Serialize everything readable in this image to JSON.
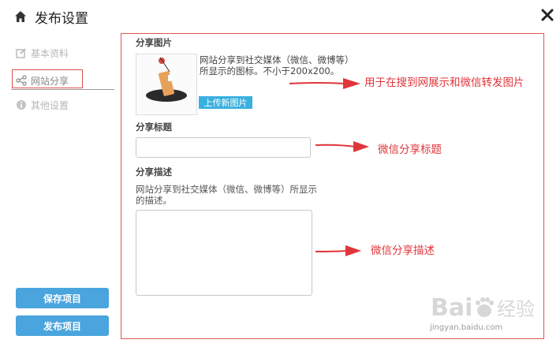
{
  "header": {
    "title": "发布设置"
  },
  "sidebar": {
    "items": [
      {
        "label": "基本资料",
        "icon": "edit-icon"
      },
      {
        "label": "网站分享",
        "icon": "share-icon"
      },
      {
        "label": "其他设置",
        "icon": "info-icon"
      }
    ],
    "save_label": "保存项目",
    "publish_label": "发布项目"
  },
  "main": {
    "share_image_label": "分享图片",
    "share_image_hint": "网站分享到社交媒体（微信、微博等）所显示的图标。不小于200x200。",
    "upload_label": "上传新图片",
    "share_title_label": "分享标题",
    "share_title_value": "",
    "share_desc_label": "分享描述",
    "share_desc_hint": "网站分享到社交媒体（微信、微博等）所显示的描述。",
    "share_desc_value": ""
  },
  "annotations": {
    "image_note": "用于在搜到网展示和微信转发图片",
    "title_note": "微信分享标题",
    "desc_note": "微信分享描述"
  },
  "watermark": {
    "brand": "Bai du 经验",
    "url": "jingyan.baidu.com"
  },
  "colors": {
    "accent": "#4aa4dd",
    "upload": "#3ab0de",
    "annotation": "#e0353a"
  }
}
